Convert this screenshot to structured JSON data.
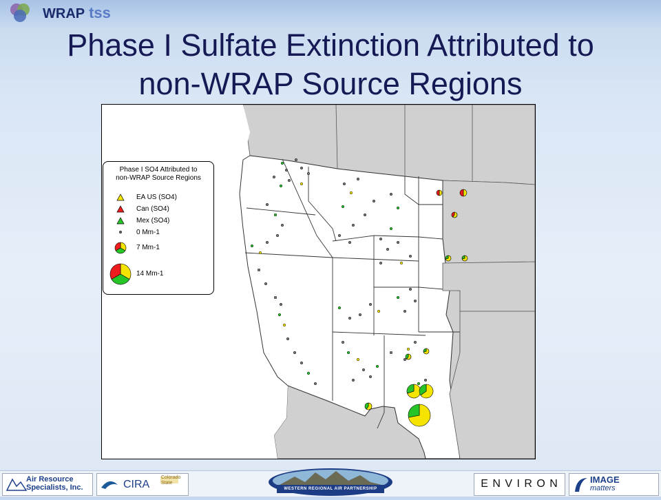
{
  "header": {
    "logo_text": "WRAP",
    "logo_suffix": "tss"
  },
  "title": {
    "line1": "Phase I Sulfate Extinction Attributed to",
    "line2": "non-WRAP Source Regions"
  },
  "legend": {
    "title_line1": "Phase I SO4 Attributed to",
    "title_line2": "non-WRAP Source Regions",
    "items": [
      {
        "label": "EA US (SO4)",
        "color": "#f4e400"
      },
      {
        "label": "Can (SO4)",
        "color": "#ee1c1c"
      },
      {
        "label": "Mex (SO4)",
        "color": "#27c427"
      }
    ],
    "sizes": [
      {
        "label": "0 Mm-1",
        "value": 0
      },
      {
        "label": "7 Mm-1",
        "value": 7
      },
      {
        "label": "14 Mm-1",
        "value": 14
      }
    ]
  },
  "colors": {
    "ea_us": "#f4e400",
    "canada": "#ee1c1c",
    "mexico": "#27c427",
    "title_text": "#151a55",
    "non_wrap_land": "#d0d0d0"
  },
  "footer": {
    "ars_line1": "Air Resource",
    "ars_line2": "Specialists, Inc.",
    "cira": "CIRA",
    "csu_line1": "Colorado",
    "csu_line2": "State",
    "wrap_banner": "WESTERN REGIONAL AIR PARTNERSHIP",
    "environ": "E N V I R O N",
    "image_matters_line1": "IMAGE",
    "image_matters_line2": "matters"
  }
}
